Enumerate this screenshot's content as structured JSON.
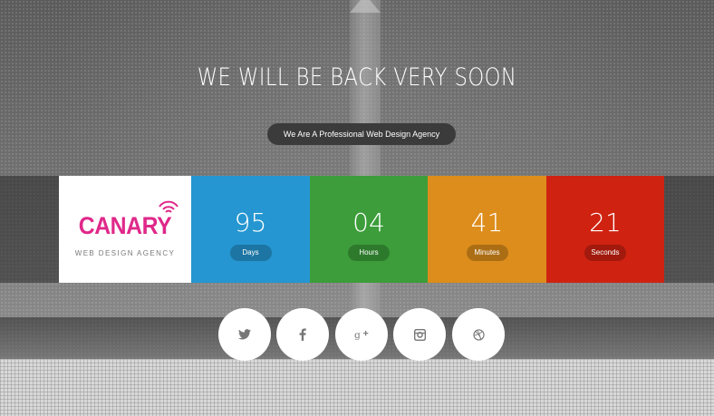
{
  "headline": "WE WILL BE BACK VERY SOON",
  "subheadline": "We Are A Professional Web Design Agency",
  "logo": {
    "name": "CANARY",
    "tagline": "WEB DESIGN AGENCY",
    "accent_color": "#e0288a",
    "icon": "wifi-signal-icon"
  },
  "countdown": [
    {
      "value": "95",
      "label": "Days",
      "color": "#2596d1"
    },
    {
      "value": "04",
      "label": "Hours",
      "color": "#3c9d3a"
    },
    {
      "value": "41",
      "label": "Minutes",
      "color": "#dd8d1b"
    },
    {
      "value": "21",
      "label": "Seconds",
      "color": "#cf2211"
    }
  ],
  "social": [
    {
      "name": "twitter",
      "icon": "twitter-icon"
    },
    {
      "name": "facebook",
      "icon": "facebook-icon"
    },
    {
      "name": "google-plus",
      "icon": "google-plus-icon"
    },
    {
      "name": "instagram",
      "icon": "instagram-icon"
    },
    {
      "name": "dribbble",
      "icon": "dribbble-icon"
    }
  ]
}
